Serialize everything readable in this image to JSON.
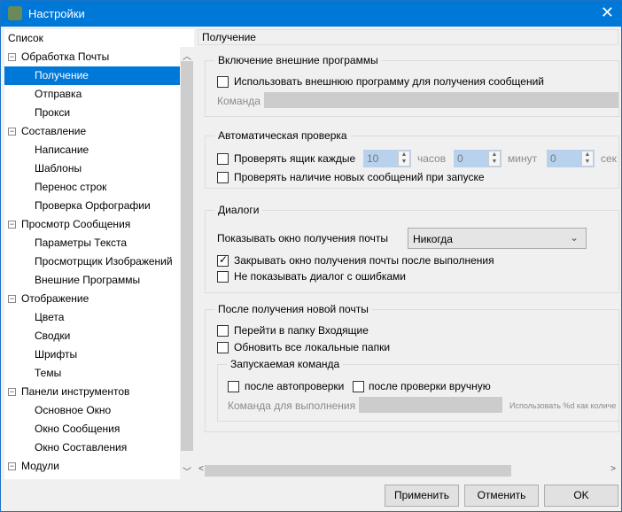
{
  "window": {
    "title": "Настройки"
  },
  "tree": {
    "header": "Список",
    "items": [
      {
        "label": "Обработка Почты",
        "group": true
      },
      {
        "label": "Получение",
        "selected": true
      },
      {
        "label": "Отправка"
      },
      {
        "label": "Прокси"
      },
      {
        "label": "Составление",
        "group": true
      },
      {
        "label": "Написание"
      },
      {
        "label": "Шаблоны"
      },
      {
        "label": "Перенос строк"
      },
      {
        "label": "Проверка Орфографии"
      },
      {
        "label": "Просмотр Сообщения",
        "group": true
      },
      {
        "label": "Параметры Текста"
      },
      {
        "label": "Просмотрщик Изображений"
      },
      {
        "label": "Внешние Программы"
      },
      {
        "label": "Отображение",
        "group": true
      },
      {
        "label": "Цвета"
      },
      {
        "label": "Сводки"
      },
      {
        "label": "Шрифты"
      },
      {
        "label": "Темы"
      },
      {
        "label": "Панели инструментов",
        "group": true
      },
      {
        "label": "Основное Окно"
      },
      {
        "label": "Окно Сообщения"
      },
      {
        "label": "Окно Составления"
      },
      {
        "label": "Модули",
        "group": true
      }
    ]
  },
  "page": {
    "title": "Получение",
    "external": {
      "title": "Включение внешние программы",
      "use_external": "Использовать внешнюю программу для получения сообщений",
      "command_label": "Команда"
    },
    "auto": {
      "title": "Автоматическая проверка",
      "check_every": "Проверять ящик каждые",
      "hours_value": "10",
      "hours": "часов",
      "minutes_value": "0",
      "minutes": "минут",
      "seconds_value": "0",
      "seconds": "сек",
      "check_on_start": "Проверять наличие новых сообщений при запуске"
    },
    "dialogs": {
      "title": "Диалоги",
      "show_window_label": "Показывать окно получения почты",
      "show_window_value": "Никогда",
      "close_after": "Закрывать окно получения почты после выполнения",
      "no_error_dialog": "Не показывать диалог с ошибками"
    },
    "after": {
      "title": "После получения новой почты",
      "go_inbox": "Перейти в папку Входящие",
      "update_local": "Обновить все локальные папки",
      "cmd_title": "Запускаемая команда",
      "after_auto": "после автопроверки",
      "after_manual": "после проверки вручную",
      "cmd_label": "Команда для выполнения",
      "hint": "Использовать %d как количе"
    }
  },
  "buttons": {
    "apply": "Применить",
    "cancel": "Отменить",
    "ok": "OK"
  }
}
